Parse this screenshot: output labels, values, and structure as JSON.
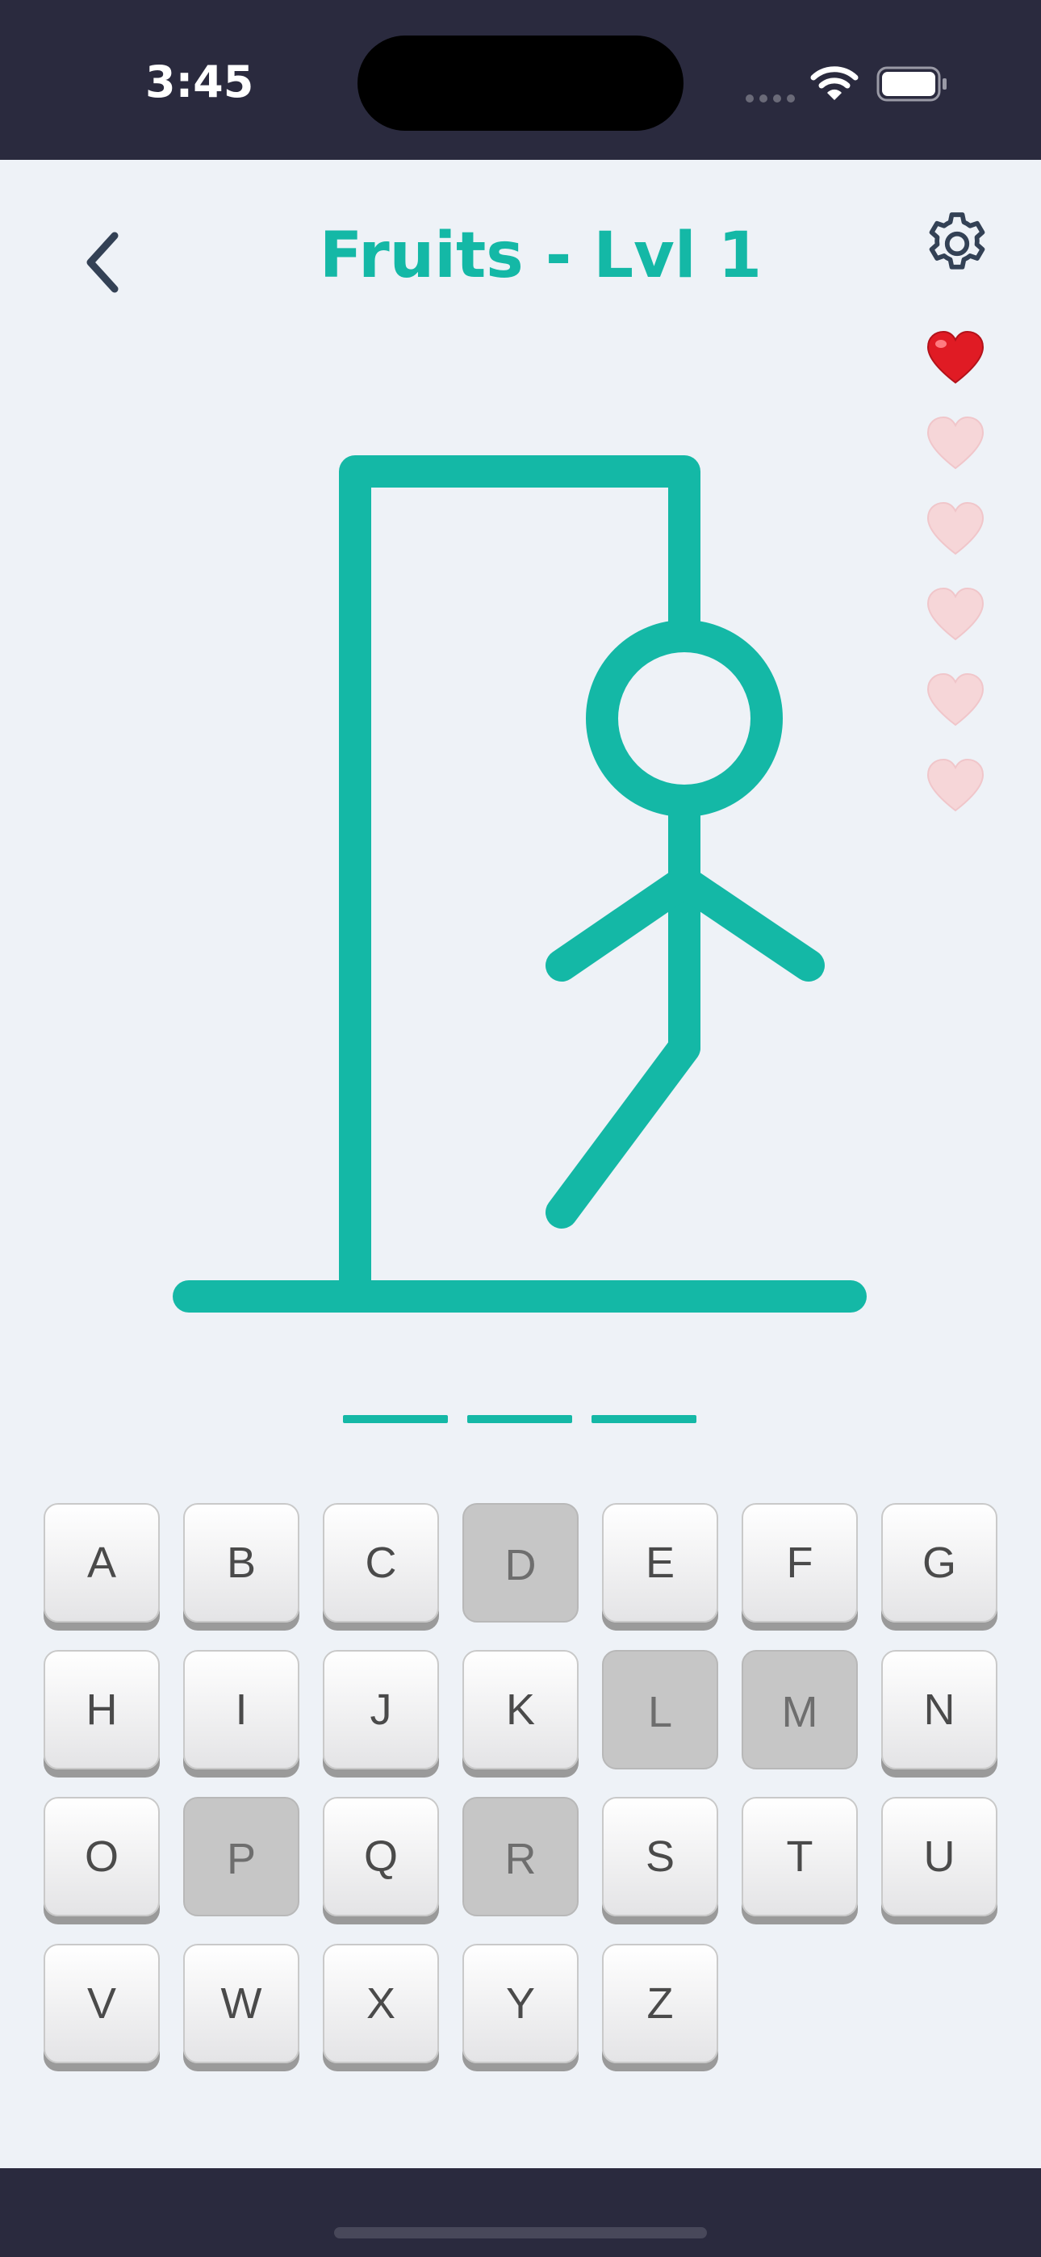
{
  "status_bar": {
    "time": "3:45"
  },
  "header": {
    "title": "Fruits - Lvl 1"
  },
  "game": {
    "theme_color": "#14b8a6",
    "lives_total": 6,
    "lives_remaining": 1,
    "word_length": 3,
    "revealed_letters": [
      "",
      "",
      ""
    ],
    "wrong_guesses": 5
  },
  "keyboard": {
    "keys": [
      {
        "label": "A",
        "used": false
      },
      {
        "label": "B",
        "used": false
      },
      {
        "label": "C",
        "used": false
      },
      {
        "label": "D",
        "used": true
      },
      {
        "label": "E",
        "used": false
      },
      {
        "label": "F",
        "used": false
      },
      {
        "label": "G",
        "used": false
      },
      {
        "label": "H",
        "used": false
      },
      {
        "label": "I",
        "used": false
      },
      {
        "label": "J",
        "used": false
      },
      {
        "label": "K",
        "used": false
      },
      {
        "label": "L",
        "used": true
      },
      {
        "label": "M",
        "used": true
      },
      {
        "label": "N",
        "used": false
      },
      {
        "label": "O",
        "used": false
      },
      {
        "label": "P",
        "used": true
      },
      {
        "label": "Q",
        "used": false
      },
      {
        "label": "R",
        "used": true
      },
      {
        "label": "S",
        "used": false
      },
      {
        "label": "T",
        "used": false
      },
      {
        "label": "U",
        "used": false
      },
      {
        "label": "V",
        "used": false
      },
      {
        "label": "W",
        "used": false
      },
      {
        "label": "X",
        "used": false
      },
      {
        "label": "Y",
        "used": false
      },
      {
        "label": "Z",
        "used": false
      }
    ]
  },
  "icons": {
    "back": "chevron-left-icon",
    "settings": "gear-icon",
    "life": "heart-icon",
    "wifi": "wifi-icon",
    "battery": "battery-icon"
  }
}
